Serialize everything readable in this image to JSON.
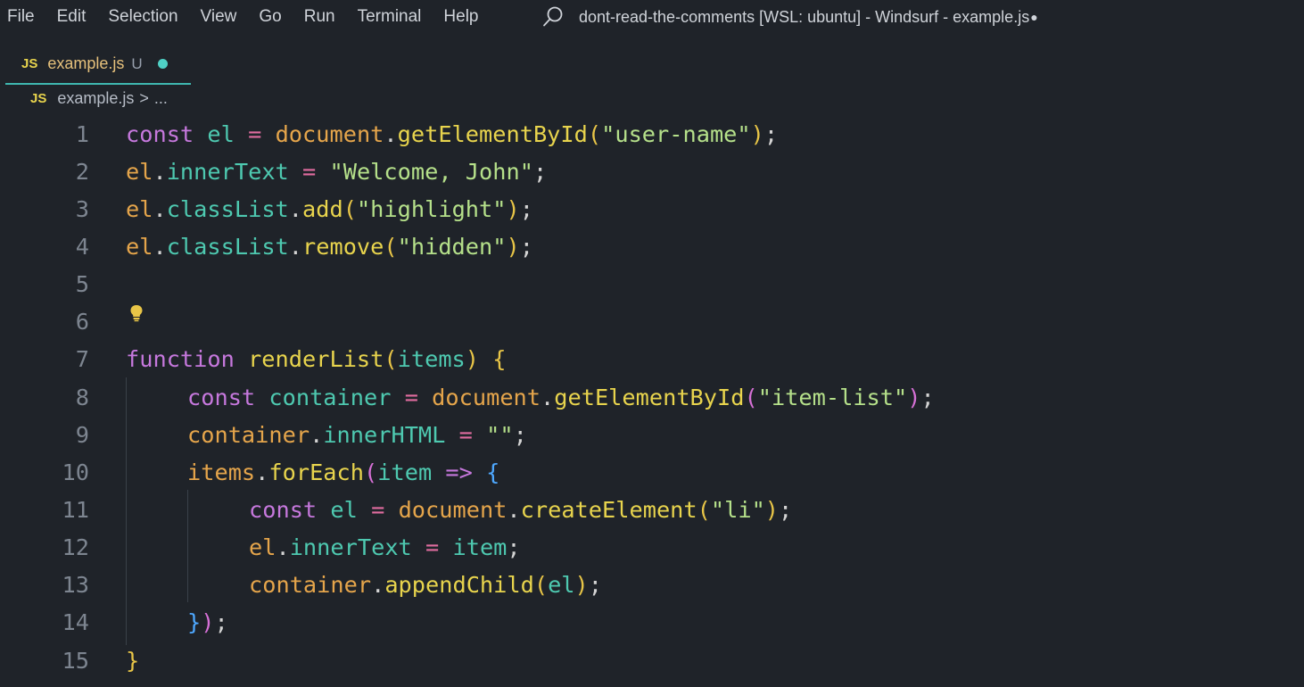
{
  "menu": [
    "File",
    "Edit",
    "Selection",
    "View",
    "Go",
    "Run",
    "Terminal",
    "Help"
  ],
  "window_title": "dont-read-the-comments [WSL: ubuntu] - Windsurf - example.js",
  "window_title_dot": "●",
  "tab": {
    "badge": "JS",
    "name": "example.js",
    "status": "U"
  },
  "breadcrumb": {
    "badge": "JS",
    "file": "example.js",
    "separator": ">",
    "rest": "..."
  },
  "lines": [
    {
      "n": "1",
      "indent": 0,
      "tokens": [
        [
          "kw",
          "const"
        ],
        [
          "pu",
          " "
        ],
        [
          "var",
          "el"
        ],
        [
          "pu",
          " "
        ],
        [
          "op",
          "="
        ],
        [
          "pu",
          " "
        ],
        [
          "obj",
          "document"
        ],
        [
          "pu",
          "."
        ],
        [
          "fn",
          "getElementById"
        ],
        [
          "p1",
          "("
        ],
        [
          "str",
          "\"user-name\""
        ],
        [
          "p1",
          ")"
        ],
        [
          "pu",
          ";"
        ]
      ]
    },
    {
      "n": "2",
      "indent": 0,
      "tokens": [
        [
          "obj",
          "el"
        ],
        [
          "pu",
          "."
        ],
        [
          "prop",
          "innerText"
        ],
        [
          "pu",
          " "
        ],
        [
          "op",
          "="
        ],
        [
          "pu",
          " "
        ],
        [
          "str",
          "\"Welcome, John\""
        ],
        [
          "pu",
          ";"
        ]
      ]
    },
    {
      "n": "3",
      "indent": 0,
      "tokens": [
        [
          "obj",
          "el"
        ],
        [
          "pu",
          "."
        ],
        [
          "prop",
          "classList"
        ],
        [
          "pu",
          "."
        ],
        [
          "fn",
          "add"
        ],
        [
          "p1",
          "("
        ],
        [
          "str",
          "\"highlight\""
        ],
        [
          "p1",
          ")"
        ],
        [
          "pu",
          ";"
        ]
      ]
    },
    {
      "n": "4",
      "indent": 0,
      "tokens": [
        [
          "obj",
          "el"
        ],
        [
          "pu",
          "."
        ],
        [
          "prop",
          "classList"
        ],
        [
          "pu",
          "."
        ],
        [
          "fn",
          "remove"
        ],
        [
          "p1",
          "("
        ],
        [
          "str",
          "\"hidden\""
        ],
        [
          "p1",
          ")"
        ],
        [
          "pu",
          ";"
        ]
      ]
    },
    {
      "n": "5",
      "indent": 0,
      "tokens": []
    },
    {
      "n": "6",
      "indent": 0,
      "tokens": []
    },
    {
      "n": "7",
      "indent": 0,
      "tokens": [
        [
          "kw",
          "function"
        ],
        [
          "pu",
          " "
        ],
        [
          "fn",
          "renderList"
        ],
        [
          "p1",
          "("
        ],
        [
          "param",
          "items"
        ],
        [
          "p1",
          ")"
        ],
        [
          "pu",
          " "
        ],
        [
          "p1",
          "{"
        ]
      ]
    },
    {
      "n": "8",
      "indent": 1,
      "tokens": [
        [
          "kw",
          "const"
        ],
        [
          "pu",
          " "
        ],
        [
          "var",
          "container"
        ],
        [
          "pu",
          " "
        ],
        [
          "op",
          "="
        ],
        [
          "pu",
          " "
        ],
        [
          "obj",
          "document"
        ],
        [
          "pu",
          "."
        ],
        [
          "fn",
          "getElementById"
        ],
        [
          "p2",
          "("
        ],
        [
          "str",
          "\"item-list\""
        ],
        [
          "p2",
          ")"
        ],
        [
          "pu",
          ";"
        ]
      ]
    },
    {
      "n": "9",
      "indent": 1,
      "tokens": [
        [
          "obj",
          "container"
        ],
        [
          "pu",
          "."
        ],
        [
          "prop",
          "innerHTML"
        ],
        [
          "pu",
          " "
        ],
        [
          "op",
          "="
        ],
        [
          "pu",
          " "
        ],
        [
          "str",
          "\"\""
        ],
        [
          "pu",
          ";"
        ]
      ]
    },
    {
      "n": "10",
      "indent": 1,
      "tokens": [
        [
          "obj",
          "items"
        ],
        [
          "pu",
          "."
        ],
        [
          "fn",
          "forEach"
        ],
        [
          "p2",
          "("
        ],
        [
          "param",
          "item"
        ],
        [
          "pu",
          " "
        ],
        [
          "kw",
          "=>"
        ],
        [
          "pu",
          " "
        ],
        [
          "p3",
          "{"
        ]
      ]
    },
    {
      "n": "11",
      "indent": 2,
      "tokens": [
        [
          "kw",
          "const"
        ],
        [
          "pu",
          " "
        ],
        [
          "var",
          "el"
        ],
        [
          "pu",
          " "
        ],
        [
          "op",
          "="
        ],
        [
          "pu",
          " "
        ],
        [
          "obj",
          "document"
        ],
        [
          "pu",
          "."
        ],
        [
          "fn",
          "createElement"
        ],
        [
          "p1",
          "("
        ],
        [
          "str",
          "\"li\""
        ],
        [
          "p1",
          ")"
        ],
        [
          "pu",
          ";"
        ]
      ]
    },
    {
      "n": "12",
      "indent": 2,
      "tokens": [
        [
          "obj",
          "el"
        ],
        [
          "pu",
          "."
        ],
        [
          "prop",
          "innerText"
        ],
        [
          "pu",
          " "
        ],
        [
          "op",
          "="
        ],
        [
          "pu",
          " "
        ],
        [
          "param",
          "item"
        ],
        [
          "pu",
          ";"
        ]
      ]
    },
    {
      "n": "13",
      "indent": 2,
      "tokens": [
        [
          "obj",
          "container"
        ],
        [
          "pu",
          "."
        ],
        [
          "fn",
          "appendChild"
        ],
        [
          "p1",
          "("
        ],
        [
          "var",
          "el"
        ],
        [
          "p1",
          ")"
        ],
        [
          "pu",
          ";"
        ]
      ]
    },
    {
      "n": "14",
      "indent": 1,
      "tokens": [
        [
          "p3",
          "}"
        ],
        [
          "p2",
          ")"
        ],
        [
          "pu",
          ";"
        ]
      ]
    },
    {
      "n": "15",
      "indent": 0,
      "tokens": [
        [
          "p1",
          "}"
        ]
      ]
    }
  ],
  "icons": {
    "search": "search-icon",
    "bulb": "lightbulb-icon"
  },
  "colors": {
    "background": "#1f2329",
    "tab_accent": "#3fb8b0",
    "modified_dot": "#4fd1c5"
  }
}
